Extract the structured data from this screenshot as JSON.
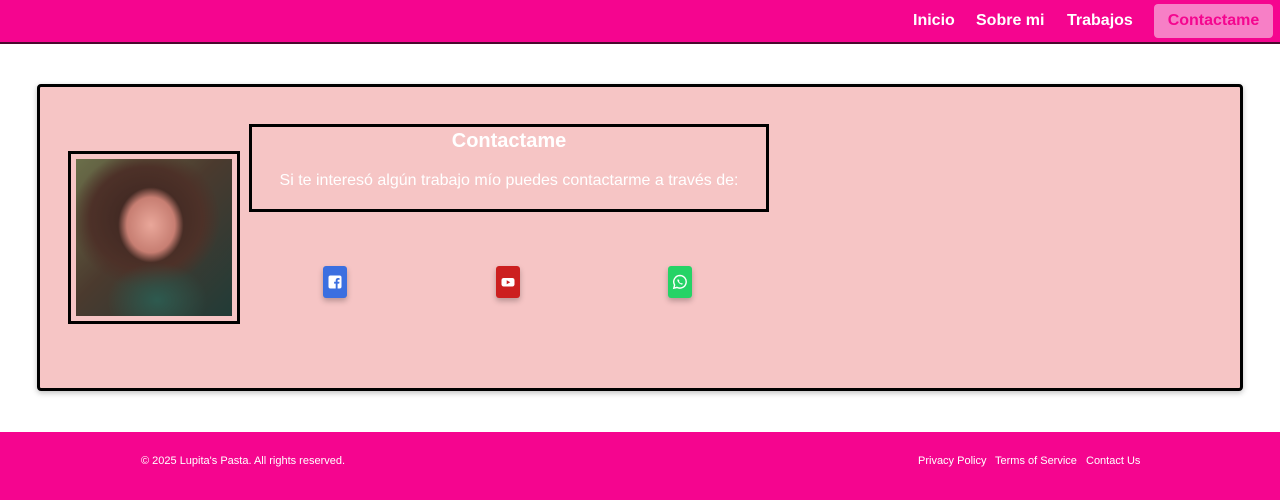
{
  "nav": {
    "items": [
      {
        "label": "Inicio"
      },
      {
        "label": "Sobre mi"
      },
      {
        "label": "Trabajos"
      },
      {
        "label": "Contactame"
      }
    ]
  },
  "contact": {
    "title": "Contactame",
    "text": "Si te interesó algún trabajo mío puedes contactarme a través de:",
    "socials": [
      {
        "icon": "facebook-icon",
        "color": "#3b6fe0"
      },
      {
        "icon": "youtube-icon",
        "color": "#cc1f1f"
      },
      {
        "icon": "whatsapp-icon",
        "color": "#25d366"
      }
    ]
  },
  "footer": {
    "copyright": "© 2025 Lupita's Pasta. All rights reserved.",
    "links": [
      "Privacy Policy",
      "Terms of Service",
      "Contact Us"
    ]
  },
  "colors": {
    "brand_pink": "#f5058f",
    "card_bg": "#f6c5c5",
    "active_nav_bg": "#f77fc6"
  }
}
